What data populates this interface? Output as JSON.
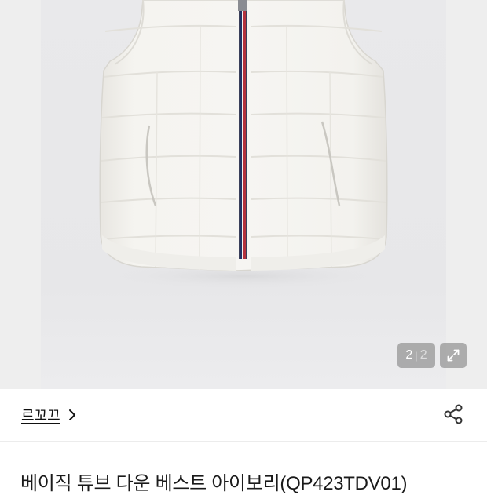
{
  "gallery": {
    "current_page": "2",
    "total_pages": "2",
    "separator": "|",
    "expand_icon": "expand-arrows-icon",
    "product_color": "#f4f3ef"
  },
  "shop": {
    "name": "르꼬끄",
    "chevron_icon": "chevron-right-icon",
    "share_icon": "share-icon"
  },
  "product": {
    "title": "베이직 튜브 다운 베스트 아이보리(QP423TDV01)"
  }
}
